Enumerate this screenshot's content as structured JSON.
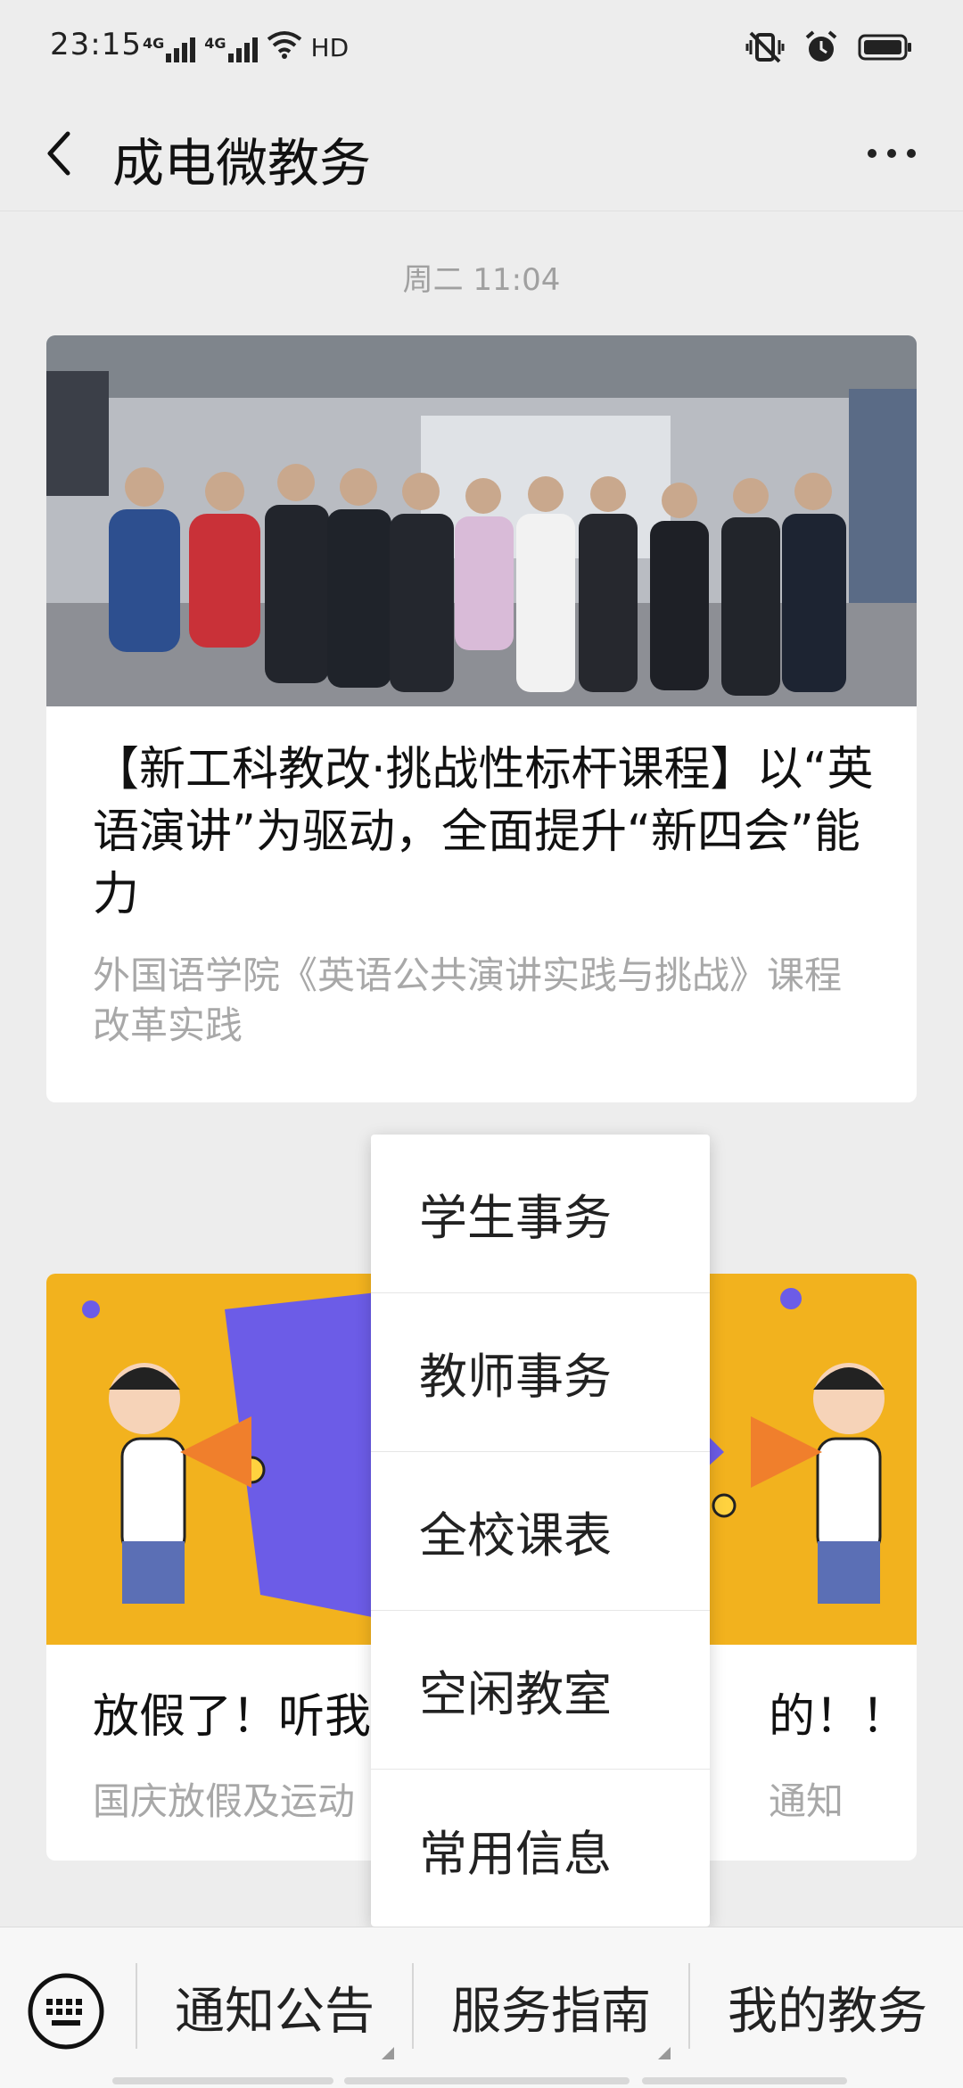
{
  "status_bar": {
    "time": "23:15",
    "network_1": "4G",
    "network_2": "4G",
    "hd_label": "HD",
    "icons": [
      "signal-icon",
      "signal-icon",
      "wifi-icon",
      "hd-icon",
      "vibrate-icon",
      "alarm-icon",
      "battery-icon"
    ]
  },
  "nav": {
    "title": "成电微教务",
    "back_icon": "chevron-left-icon",
    "more_icon": "more-dots-icon"
  },
  "timestamp": "周二 11:04",
  "articles": [
    {
      "title": "【新工科教改·挑战性标杆课程】以“英语演讲”为驱动，全面提升“新四会”能力",
      "summary": "外国语学院《英语公共演讲实践与挑战》课程改革实践",
      "image": "group-photo"
    },
    {
      "title": "放假了！听我",
      "title_end": "的！！",
      "summary": "国庆放假及运动",
      "summary_end": "通知",
      "image": "holiday-poster"
    }
  ],
  "popup_menu": {
    "items": [
      "学生事务",
      "教师事务",
      "全校课表",
      "空闲教室",
      "常用信息"
    ]
  },
  "bottom_menu": {
    "keyboard_icon": "keyboard-icon",
    "items": [
      "通知公告",
      "服务指南",
      "我的教务"
    ]
  },
  "colors": {
    "background": "#ededed",
    "poster_yellow": "#f2b21e",
    "poster_purple": "#6c5ce7"
  }
}
